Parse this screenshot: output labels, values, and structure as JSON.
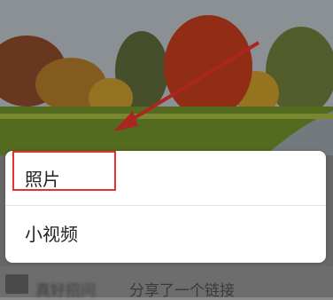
{
  "menu": {
    "photo_label": "照片",
    "video_label": "小视频"
  },
  "background": {
    "share_caption": "分享了一个链接",
    "blurred_name": "真好招问"
  },
  "colors": {
    "annotation_red": "#e5322d",
    "sheet_bg": "#ffffff"
  }
}
